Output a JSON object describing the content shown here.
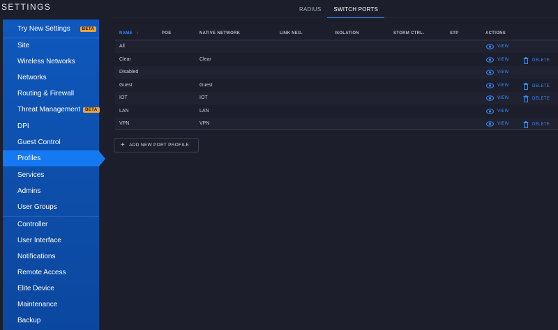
{
  "settings_title": "SETTINGS",
  "sidebar": {
    "try_new": {
      "label": "Try New Settings",
      "badge": "BETA"
    },
    "items": [
      {
        "label": "Site"
      },
      {
        "label": "Wireless Networks"
      },
      {
        "label": "Networks"
      },
      {
        "label": "Routing & Firewall"
      },
      {
        "label": "Threat Management",
        "badge": "BETA"
      },
      {
        "label": "DPI"
      },
      {
        "label": "Guest Control"
      },
      {
        "label": "Profiles"
      },
      {
        "label": "Services"
      },
      {
        "label": "Admins"
      },
      {
        "label": "User Groups"
      }
    ],
    "items2": [
      {
        "label": "Controller"
      },
      {
        "label": "User Interface"
      },
      {
        "label": "Notifications"
      },
      {
        "label": "Remote Access"
      },
      {
        "label": "Elite Device"
      },
      {
        "label": "Maintenance"
      },
      {
        "label": "Backup"
      }
    ]
  },
  "tabs": [
    {
      "label": "RADIUS"
    },
    {
      "label": "SWITCH PORTS"
    }
  ],
  "table": {
    "headers": {
      "name": "NAME",
      "name_sort": "↑",
      "poe": "POE",
      "native_network": "NATIVE NETWORK",
      "link_neg": "LINK NEG.",
      "isolation": "ISOLATION",
      "storm_ctrl": "STORM CTRL.",
      "stp": "STP",
      "actions": "ACTIONS"
    },
    "view_label": "VIEW",
    "delete_label": "DELETE",
    "rows": [
      {
        "name": "All",
        "native": ""
      },
      {
        "name": "Clear",
        "native": "Clear"
      },
      {
        "name": "Disabled",
        "native": ""
      },
      {
        "name": "Guest",
        "native": "Guest"
      },
      {
        "name": "IOT",
        "native": "IOT"
      },
      {
        "name": "LAN",
        "native": "LAN"
      },
      {
        "name": "VPN",
        "native": "VPN"
      }
    ]
  },
  "add_button": "ADD NEW PORT PROFILE",
  "colors": {
    "accent": "#2f8cff",
    "sidebar_blue": "#0f58bd",
    "active_blue": "#1479f3",
    "badge": "#e9a23b",
    "background": "#1d1e2b"
  }
}
